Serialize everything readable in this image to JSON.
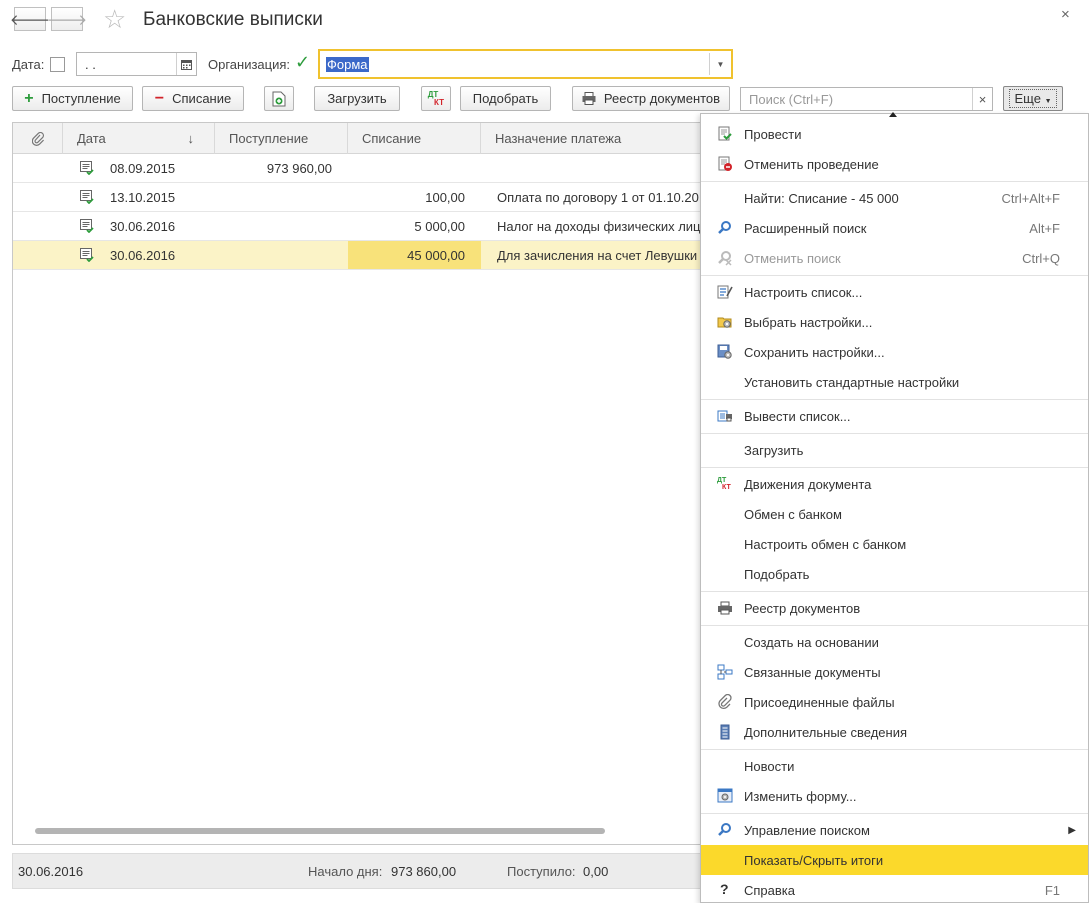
{
  "window": {
    "title": "Банковские выписки",
    "close_glyph": "×"
  },
  "nav": {
    "back_glyph": "🡐",
    "forward_glyph": "🡒",
    "star_glyph": "☆"
  },
  "filter": {
    "date_label": "Дата:",
    "date_value": " .  .",
    "org_label": "Организация:",
    "org_value": "Форма",
    "org_checked": "✓"
  },
  "toolbar": {
    "add_income_label": "Поступление",
    "add_income_glyph": "+",
    "add_expense_label": "Списание",
    "add_expense_glyph": "−",
    "load_label": "Загрузить",
    "dtkt_top": "ДТ",
    "dtkt_bottom": "КТ",
    "match_label": "Подобрать",
    "registry_label": "Реестр документов",
    "search_placeholder": "Поиск (Ctrl+F)",
    "search_clear": "×",
    "more_label": "Еще"
  },
  "table": {
    "columns": [
      "Дата",
      "Поступление",
      "Списание",
      "Назначение платежа"
    ],
    "sort_glyph": "↓",
    "rows": [
      {
        "date": "08.09.2015",
        "income": "973 960,00",
        "expense": "",
        "purpose": ""
      },
      {
        "date": "13.10.2015",
        "income": "",
        "expense": "100,00",
        "purpose": "Оплата по договору 1 от 01.10.20"
      },
      {
        "date": "30.06.2016",
        "income": "",
        "expense": "5 000,00",
        "purpose": "Налог на доходы физических лиц"
      },
      {
        "date": "30.06.2016",
        "income": "",
        "expense": "45 000,00",
        "purpose": "Для зачисления на счет Левушки"
      }
    ]
  },
  "footer": {
    "date": "30.06.2016",
    "start_label": "Начало дня:",
    "start_value": "973 860,00",
    "income_label": "Поступило:",
    "income_value": "0,00"
  },
  "menu": {
    "items": [
      {
        "label": "Провести",
        "shortcut": ""
      },
      {
        "label": "Отменить проведение",
        "shortcut": ""
      },
      {
        "label": "Найти: Списание - 45 000",
        "shortcut": "Ctrl+Alt+F"
      },
      {
        "label": "Расширенный поиск",
        "shortcut": "Alt+F"
      },
      {
        "label": "Отменить поиск",
        "shortcut": "Ctrl+Q"
      },
      {
        "label": "Настроить список...",
        "shortcut": ""
      },
      {
        "label": "Выбрать настройки...",
        "shortcut": ""
      },
      {
        "label": "Сохранить настройки...",
        "shortcut": ""
      },
      {
        "label": "Установить стандартные настройки",
        "shortcut": ""
      },
      {
        "label": "Вывести список...",
        "shortcut": ""
      },
      {
        "label": "Загрузить",
        "shortcut": ""
      },
      {
        "label": "Движения документа",
        "shortcut": ""
      },
      {
        "label": "Обмен с банком",
        "shortcut": ""
      },
      {
        "label": "Настроить обмен с банком",
        "shortcut": ""
      },
      {
        "label": "Подобрать",
        "shortcut": ""
      },
      {
        "label": "Реестр документов",
        "shortcut": ""
      },
      {
        "label": "Создать на основании",
        "shortcut": ""
      },
      {
        "label": "Связанные документы",
        "shortcut": ""
      },
      {
        "label": "Присоединенные файлы",
        "shortcut": ""
      },
      {
        "label": "Дополнительные сведения",
        "shortcut": ""
      },
      {
        "label": "Новости",
        "shortcut": ""
      },
      {
        "label": "Изменить форму...",
        "shortcut": ""
      },
      {
        "label": "Управление поиском",
        "shortcut": ""
      },
      {
        "label": "Показать/Скрыть итоги",
        "shortcut": ""
      },
      {
        "label": "Справка",
        "shortcut": "F1"
      }
    ],
    "dtkt_top": "ДТ",
    "dtkt_bottom": "КТ",
    "help_glyph": "?",
    "submenu_glyph": "▶"
  },
  "colors": {
    "highlight": "#fbd92b",
    "selected_row": "#fbf3c7",
    "org_focus_border": "#f0c22e",
    "accent_green": "#2d9c3c",
    "accent_red": "#d2232a"
  }
}
